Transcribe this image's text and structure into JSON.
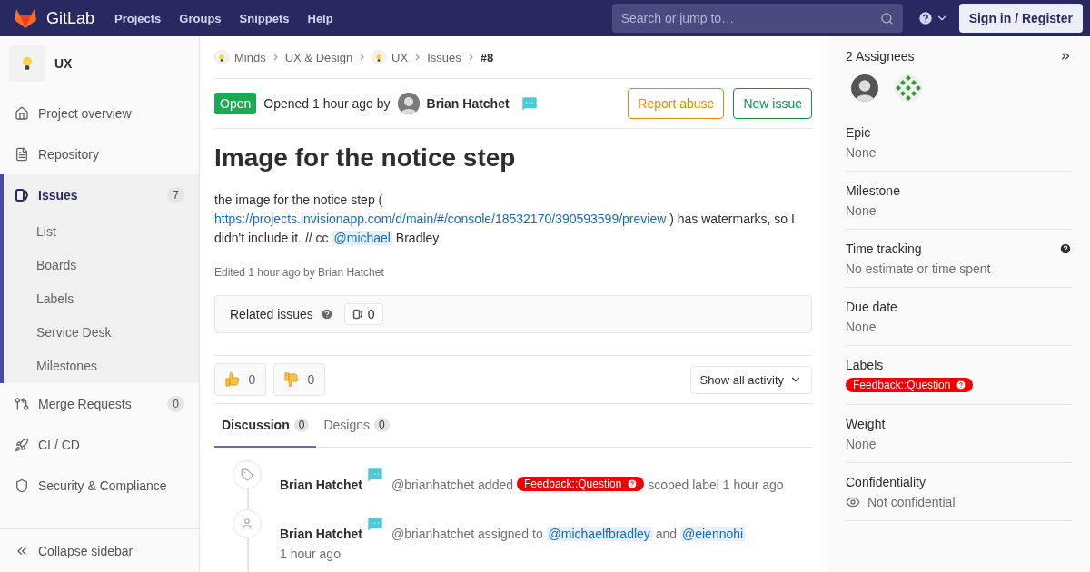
{
  "header": {
    "logo": "GitLab",
    "nav": [
      {
        "label": "Projects"
      },
      {
        "label": "Groups"
      },
      {
        "label": "Snippets"
      },
      {
        "label": "Help"
      }
    ],
    "search": {
      "placeholder": "Search or jump to…"
    },
    "sign_in": "Sign in / Register"
  },
  "sidebar": {
    "project": "UX",
    "items": [
      {
        "kind": "home",
        "label": "Project overview",
        "selected": false
      },
      {
        "kind": "file",
        "label": "Repository",
        "selected": false
      },
      {
        "kind": "issues",
        "label": "Issues",
        "count": "7",
        "selected": true,
        "children": [
          {
            "label": "List"
          },
          {
            "label": "Boards"
          },
          {
            "label": "Labels"
          },
          {
            "label": "Service Desk"
          },
          {
            "label": "Milestones"
          }
        ]
      },
      {
        "kind": "merge",
        "label": "Merge Requests",
        "count": "0",
        "selected": false
      },
      {
        "kind": "rocket",
        "label": "CI / CD",
        "selected": false
      },
      {
        "kind": "shield",
        "label": "Security & Compliance",
        "selected": false
      }
    ],
    "collapse": "Collapse sidebar"
  },
  "breadcrumbs": [
    {
      "label": "Minds",
      "avatar": true,
      "selected": false
    },
    {
      "label": "UX & Design",
      "avatar": false,
      "selected": false
    },
    {
      "label": "UX",
      "avatar": true,
      "selected": false
    },
    {
      "label": "Issues",
      "avatar": false,
      "selected": false
    },
    {
      "label": "#8",
      "avatar": false,
      "selected": true
    }
  ],
  "issue": {
    "status": "Open",
    "opened": "Opened 1 hour ago by",
    "author": "Brian Hatchet",
    "buttons": [
      {
        "kind": "warning",
        "label": "Report abuse"
      },
      {
        "kind": "success",
        "label": "New issue"
      }
    ],
    "title": "Image for the notice step",
    "description": [
      {
        "kind": "text",
        "text": "the image for the notice step ("
      },
      {
        "kind": "link",
        "text": "https://projects.invisionapp.com/d/main/#/console/18532170/390593599/preview"
      },
      {
        "kind": "text",
        "text": ") has watermarks, so I didn't include it. // cc"
      },
      {
        "kind": "mention",
        "text": "@michael"
      },
      {
        "kind": "text",
        "text": "Bradley"
      }
    ],
    "edited": "Edited 1 hour ago by Brian Hatchet"
  },
  "related": {
    "label": "Related issues",
    "count": "0"
  },
  "awards": [
    {
      "kind": "thumbsup",
      "count": "0"
    },
    {
      "kind": "thumbsdown",
      "count": "0"
    }
  ],
  "activity_filter": "Show all activity",
  "tabs": [
    {
      "label": "Discussion",
      "count": "0",
      "selected": true
    },
    {
      "label": "Designs",
      "count": "0",
      "selected": false
    }
  ],
  "notes": [
    {
      "kind": "label",
      "author": "Brian Hatchet",
      "parts": [
        {
          "kind": "text",
          "text": "@brianhatchet added"
        },
        {
          "kind": "label",
          "text": "Feedback::Question",
          "color": "#ee0000"
        },
        {
          "kind": "text",
          "text": "scoped label 1 hour ago"
        }
      ]
    },
    {
      "kind": "user",
      "author": "Brian Hatchet",
      "parts": [
        {
          "kind": "text",
          "text": "@brianhatchet assigned to"
        },
        {
          "kind": "mention",
          "text": "@michaelfbradley"
        },
        {
          "kind": "text",
          "text": "and"
        },
        {
          "kind": "mention",
          "text": "@eiennohi"
        }
      ],
      "time": "1 hour ago"
    }
  ],
  "right": {
    "assignees": {
      "title": "2 Assignees",
      "avatars": [
        {
          "kind": "photo"
        },
        {
          "kind": "identicon"
        }
      ]
    },
    "sections": [
      {
        "kind": "plain",
        "title": "Epic",
        "value": "None"
      },
      {
        "kind": "plain",
        "title": "Milestone",
        "value": "None"
      },
      {
        "kind": "help",
        "title": "Time tracking",
        "value": "No estimate or time spent"
      },
      {
        "kind": "plain",
        "title": "Due date",
        "value": "None"
      },
      {
        "kind": "label",
        "title": "Labels",
        "label": {
          "text": "Feedback::Question",
          "color": "#ee0000"
        }
      },
      {
        "kind": "plain",
        "title": "Weight",
        "value": "None"
      },
      {
        "kind": "visibility",
        "title": "Confidentiality",
        "value": "Not confidential"
      }
    ]
  }
}
